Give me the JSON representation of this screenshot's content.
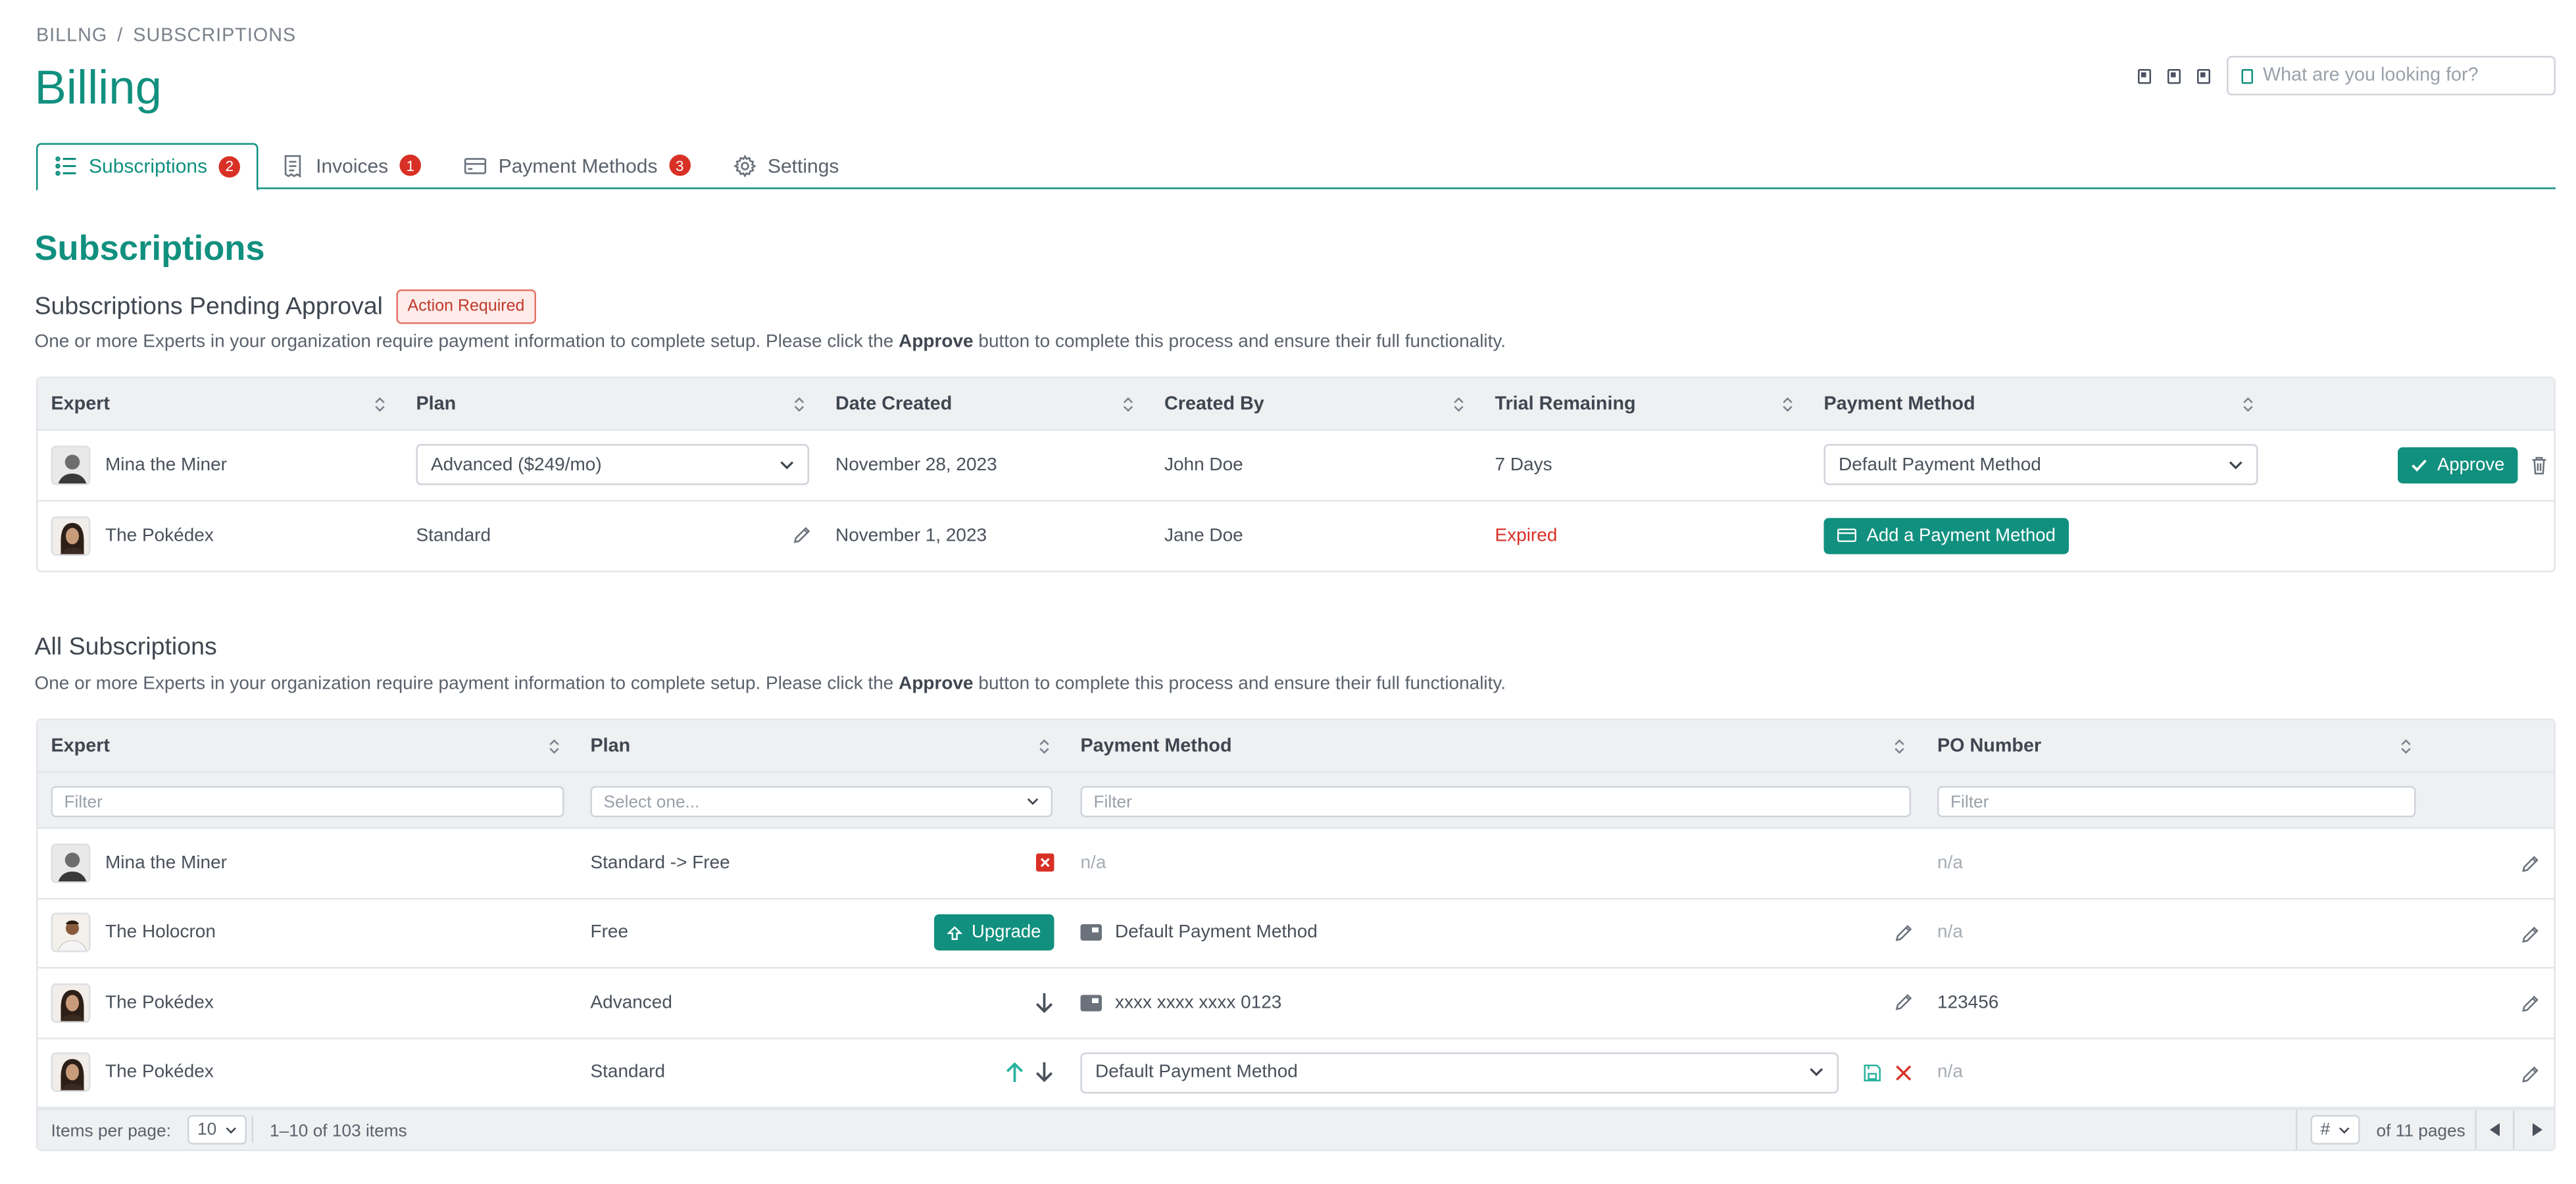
{
  "breadcrumb": {
    "items": [
      "BILLNG",
      "SUBSCRIPTIONS"
    ],
    "separator": "/"
  },
  "page": {
    "title": "Billing"
  },
  "search": {
    "placeholder": "What are you looking for?"
  },
  "tabs": [
    {
      "label": "Subscriptions",
      "badge": "2",
      "active": true,
      "icon": "list-icon"
    },
    {
      "label": "Invoices",
      "badge": "1",
      "icon": "receipt-icon"
    },
    {
      "label": "Payment Methods",
      "badge": "3",
      "icon": "credit-card-icon"
    },
    {
      "label": "Settings",
      "icon": "gear-icon"
    }
  ],
  "subscriptions": {
    "title": "Subscriptions",
    "pending": {
      "title": "Subscriptions Pending Approval",
      "tag": "Action Required",
      "description_pre": "One or more Experts in your organization require payment information to complete setup. Please click the",
      "description_bold": "Approve",
      "description_post": "button to complete this process and ensure their full functionality.",
      "columns": [
        "Expert",
        "Plan",
        "Date Created",
        "Created By",
        "Trial Remaining",
        "Payment Method"
      ],
      "rows": [
        {
          "expert": "Mina the Miner",
          "plan": "Advanced ($249/mo)",
          "date": "November 28, 2023",
          "created_by": "John Doe",
          "trial": "7 Days",
          "payment": "Default Payment Method",
          "action": "Approve"
        },
        {
          "expert": "The Pokédex",
          "plan": "Standard",
          "date": "November 1, 2023",
          "created_by": "Jane Doe",
          "trial": "Expired",
          "payment": "Add a Payment Method"
        }
      ]
    },
    "all": {
      "title": "All Subscriptions",
      "description_pre": "One or more Experts in your organization require payment information to complete setup. Please click the",
      "description_bold": "Approve",
      "description_post": "button to complete this process and ensure their full functionality.",
      "columns": [
        "Expert",
        "Plan",
        "Payment Method",
        "PO Number"
      ],
      "filters": {
        "expert": "Filter",
        "plan": "Select one...",
        "payment": "Filter",
        "po": "Filter"
      },
      "rows": [
        {
          "expert": "Mina the Miner",
          "plan": "Standard -> Free",
          "payment": "n/a",
          "po": "n/a"
        },
        {
          "expert": "The Holocron",
          "plan": "Free",
          "plan_action": "Upgrade",
          "payment": "Default Payment Method",
          "po": "n/a"
        },
        {
          "expert": "The Pokédex",
          "plan": "Advanced",
          "payment": "xxxx xxxx xxxx 0123",
          "po": "123456"
        },
        {
          "expert": "The Pokédex",
          "plan": "Standard",
          "payment": "Default Payment Method",
          "po": "n/a"
        }
      ],
      "footer": {
        "items_per_page_label": "Items per page:",
        "items_per_page": "10",
        "range": "1–10 of 103 items",
        "page_select": "#",
        "pages": "of 11 pages"
      }
    }
  },
  "colors": {
    "accent": "#11907f",
    "danger": "#d93025"
  }
}
